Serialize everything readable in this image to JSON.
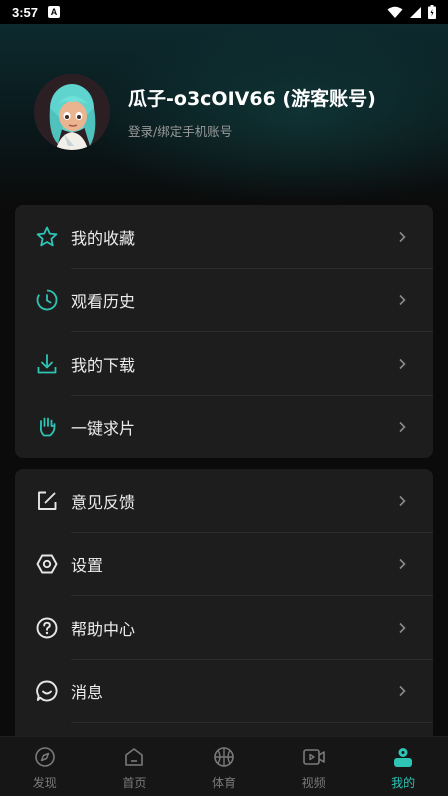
{
  "status": {
    "time": "3:57",
    "notif": "A"
  },
  "profile": {
    "name": "瓜子-o3cOIV66 (游客账号)",
    "subtitle": "登录/绑定手机账号"
  },
  "menu_group_1": [
    {
      "label": "我的收藏",
      "icon": "star-icon"
    },
    {
      "label": "观看历史",
      "icon": "clock-icon"
    },
    {
      "label": "我的下载",
      "icon": "download-icon"
    },
    {
      "label": "一键求片",
      "icon": "hand-icon"
    }
  ],
  "menu_group_2": [
    {
      "label": "意见反馈",
      "icon": "edit-icon"
    },
    {
      "label": "设置",
      "icon": "settings-icon"
    },
    {
      "label": "帮助中心",
      "icon": "help-icon"
    },
    {
      "label": "消息",
      "icon": "message-icon"
    }
  ],
  "tabs": [
    {
      "label": "发现",
      "icon": "compass-icon"
    },
    {
      "label": "首页",
      "icon": "home-icon"
    },
    {
      "label": "体育",
      "icon": "basketball-icon"
    },
    {
      "label": "视频",
      "icon": "video-icon"
    },
    {
      "label": "我的",
      "icon": "profile-icon",
      "active": true
    }
  ],
  "colors": {
    "accent": "#2ec4b6",
    "card": "#1d1d1d",
    "background": "#0b0b0b"
  }
}
